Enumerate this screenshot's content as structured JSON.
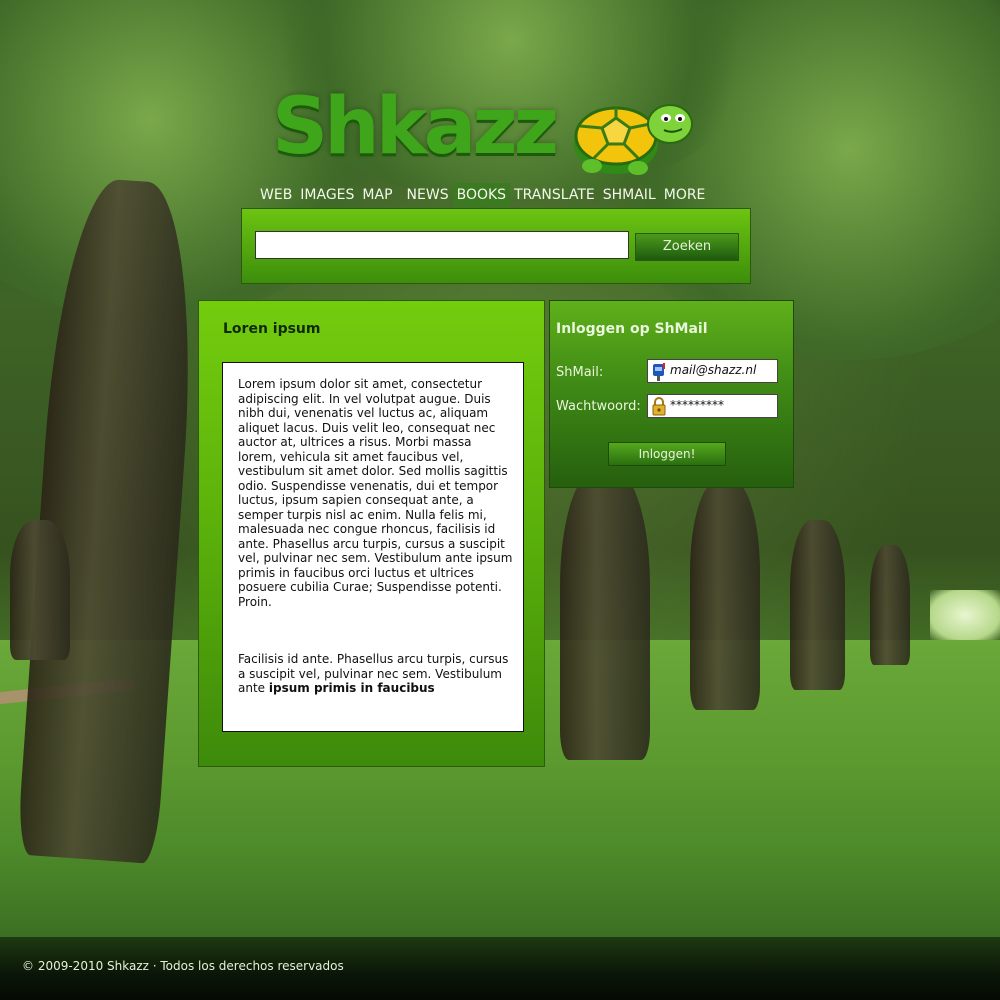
{
  "logo": {
    "text": "Shkazz",
    "mascot": "turtle-icon"
  },
  "nav": {
    "items": [
      {
        "label": "WEB"
      },
      {
        "label": "IMAGES"
      },
      {
        "label": "MAP"
      },
      {
        "label": "NEWS"
      },
      {
        "label": "BOOKS",
        "active": true
      },
      {
        "label": "TRANSLATE"
      },
      {
        "label": "SHMAIL"
      },
      {
        "label": "MORE"
      }
    ]
  },
  "search": {
    "value": "",
    "button_label": "Zoeken"
  },
  "content": {
    "title": "Loren ipsum",
    "paragraph1": "Lorem ipsum dolor sit amet, consectetur adipiscing elit. In vel volutpat augue. Duis nibh dui, venenatis vel luctus ac, aliquam aliquet lacus. Duis velit leo, consequat nec auctor at, ultrices a risus. Morbi massa lorem, vehicula sit amet faucibus vel, vestibulum sit amet dolor. Sed mollis sagittis odio. Suspendisse venenatis, dui et tempor luctus, ipsum sapien consequat ante, a semper turpis nisl ac enim. Nulla felis mi, malesuada nec congue rhoncus, facilisis id ante. Phasellus arcu turpis, cursus a suscipit vel, pulvinar nec sem. Vestibulum ante ipsum primis in faucibus orci luctus et ultrices posuere cubilia Curae; Suspendisse potenti. Proin.",
    "paragraph2_plain": "Facilisis id ante. Phasellus arcu turpis, cursus a suscipit vel, pulvinar nec sem. Vestibulum ante ",
    "paragraph2_bold": "ipsum primis in faucibus"
  },
  "login": {
    "title": "Inloggen op ShMail",
    "email_label": "ShMail:",
    "email_value": "mail@shazz.nl",
    "email_icon": "mailbox-icon",
    "password_label": "Wachtwoord:",
    "password_value": "*********",
    "password_icon": "padlock-icon",
    "button_label": "Inloggen!"
  },
  "footer": {
    "text": "© 2009-2010 Shkazz  ·  Todos los derechos reservados"
  },
  "colors": {
    "accent": "#6cc411",
    "dark_green": "#2d5c0c",
    "footer": "#0a1507"
  }
}
